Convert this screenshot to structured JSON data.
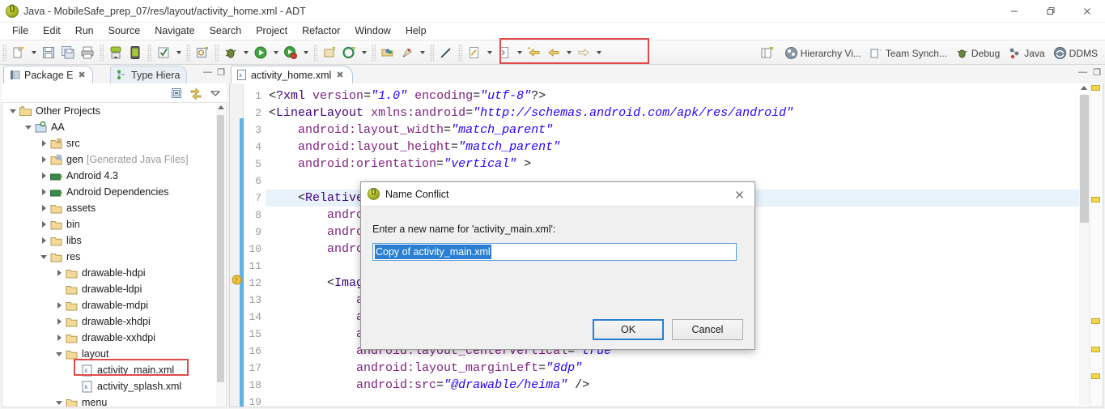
{
  "window": {
    "title": "Java - MobileSafe_prep_07/res/layout/activity_home.xml - ADT",
    "minimize_label": "Minimize",
    "restore_label": "Restore",
    "close_label": "Close"
  },
  "menubar": {
    "items": [
      {
        "label": "File"
      },
      {
        "label": "Edit"
      },
      {
        "label": "Run"
      },
      {
        "label": "Source"
      },
      {
        "label": "Navigate"
      },
      {
        "label": "Search"
      },
      {
        "label": "Project"
      },
      {
        "label": "Refactor"
      },
      {
        "label": "Window"
      },
      {
        "label": "Help"
      }
    ]
  },
  "toolbar": {
    "highlight_color": "#e04a4a",
    "buttons": [
      {
        "name": "new-wizard",
        "icon": "new-file-icon"
      },
      {
        "name": "save",
        "icon": "save-icon"
      },
      {
        "name": "save-all",
        "icon": "save-all-icon"
      },
      {
        "name": "print",
        "icon": "print-icon"
      },
      {
        "name": "android-sdk-manager",
        "icon": "sdk-manager-icon"
      },
      {
        "name": "android-virtual-device-manager",
        "icon": "avd-manager-icon"
      },
      {
        "name": "toggle-mark-occurrences",
        "icon": "checkbox-icon"
      },
      {
        "name": "new-android-project",
        "icon": "android-project-icon"
      },
      {
        "name": "debug",
        "icon": "debug-bug-icon"
      },
      {
        "name": "run",
        "icon": "run-play-icon"
      },
      {
        "name": "run-coverage",
        "icon": "coverage-icon"
      },
      {
        "name": "new-java-package",
        "icon": "package-icon"
      },
      {
        "name": "new-java-class",
        "icon": "java-class-icon"
      },
      {
        "name": "open-type",
        "icon": "open-type-icon"
      },
      {
        "name": "external-tools",
        "icon": "external-tools-icon"
      },
      {
        "name": "search",
        "icon": "search-pencil-icon"
      },
      {
        "name": "last-edit-location",
        "icon": "last-edit-icon"
      },
      {
        "name": "next-annotation",
        "icon": "next-annotation-icon"
      },
      {
        "name": "previous-edit",
        "icon": "previous-edit-icon"
      },
      {
        "name": "back",
        "icon": "back-arrow-icon"
      },
      {
        "name": "forward",
        "icon": "forward-arrow-icon"
      }
    ],
    "perspectives": [
      {
        "label": "",
        "icon": "open-perspective-icon",
        "name": "open-perspective"
      },
      {
        "label": "Hierarchy Vi...",
        "icon": "hierarchy-view-icon",
        "name": "perspective-hierarchy-view"
      },
      {
        "label": "Team Synch...",
        "icon": "team-sync-icon",
        "name": "perspective-team-sync"
      },
      {
        "label": "Debug",
        "icon": "debug-perspective-icon",
        "name": "perspective-debug"
      },
      {
        "label": "Java",
        "icon": "java-perspective-icon",
        "name": "perspective-java"
      },
      {
        "label": "DDMS",
        "icon": "ddms-icon",
        "name": "perspective-ddms"
      }
    ]
  },
  "left_view": {
    "tabs": [
      {
        "label": "Package E",
        "icon": "package-explorer-icon",
        "active": true,
        "close": "✖"
      },
      {
        "label": "Type Hiera",
        "icon": "type-hierarchy-icon",
        "active": false
      }
    ],
    "view_controls": {
      "minimize": "—",
      "maximize": "❐"
    },
    "toolbar": [
      {
        "name": "collapse-all",
        "icon": "collapse-all-icon"
      },
      {
        "name": "link-with-editor",
        "icon": "link-editor-icon"
      },
      {
        "name": "view-menu",
        "icon": "view-menu-icon"
      }
    ],
    "tree": [
      {
        "label": "Other Projects",
        "indent": 0,
        "state": "open",
        "icon": "project-group-icon"
      },
      {
        "label": "AA",
        "indent": 1,
        "state": "open",
        "icon": "java-project-icon"
      },
      {
        "label": "src",
        "indent": 2,
        "state": "closed",
        "icon": "source-folder-icon"
      },
      {
        "label": "gen",
        "suffix": "[Generated Java Files]",
        "indent": 2,
        "state": "closed",
        "icon": "gen-folder-icon"
      },
      {
        "label": "Android 4.3",
        "indent": 2,
        "state": "closed",
        "icon": "android-library-icon"
      },
      {
        "label": "Android Dependencies",
        "indent": 2,
        "state": "closed",
        "icon": "android-library-icon"
      },
      {
        "label": "assets",
        "indent": 2,
        "state": "closed",
        "icon": "folder-icon"
      },
      {
        "label": "bin",
        "indent": 2,
        "state": "closed",
        "icon": "folder-icon"
      },
      {
        "label": "libs",
        "indent": 2,
        "state": "closed",
        "icon": "folder-icon"
      },
      {
        "label": "res",
        "indent": 2,
        "state": "open",
        "icon": "folder-icon"
      },
      {
        "label": "drawable-hdpi",
        "indent": 3,
        "state": "closed",
        "icon": "folder-icon"
      },
      {
        "label": "drawable-ldpi",
        "indent": 3,
        "state": "leaf",
        "icon": "folder-icon"
      },
      {
        "label": "drawable-mdpi",
        "indent": 3,
        "state": "closed",
        "icon": "folder-icon"
      },
      {
        "label": "drawable-xhdpi",
        "indent": 3,
        "state": "closed",
        "icon": "folder-icon"
      },
      {
        "label": "drawable-xxhdpi",
        "indent": 3,
        "state": "closed",
        "icon": "folder-icon"
      },
      {
        "label": "layout",
        "indent": 3,
        "state": "open",
        "icon": "folder-icon"
      },
      {
        "label": "activity_main.xml",
        "indent": 4,
        "state": "leaf",
        "icon": "xml-file-icon",
        "highlighted": true
      },
      {
        "label": "activity_splash.xml",
        "indent": 4,
        "state": "leaf",
        "icon": "xml-file-icon"
      },
      {
        "label": "menu",
        "indent": 3,
        "state": "open",
        "icon": "folder-icon"
      }
    ]
  },
  "editor": {
    "tab": {
      "label": "activity_home.xml",
      "icon": "xml-file-icon",
      "close": "✖"
    },
    "controls": {
      "minimize": "—",
      "maximize": "❐"
    },
    "current_line": 7,
    "warning_line": 12,
    "lines": [
      {
        "n": 1,
        "text": "<?xml version=\"1.0\" encoding=\"utf-8\"?>"
      },
      {
        "n": 2,
        "text": "<LinearLayout xmlns:android=\"http://schemas.android.com/apk/res/android\""
      },
      {
        "n": 3,
        "text": "    android:layout_width=\"match_parent\""
      },
      {
        "n": 4,
        "text": "    android:layout_height=\"match_parent\""
      },
      {
        "n": 5,
        "text": "    android:orientation=\"vertical\" >"
      },
      {
        "n": 6,
        "text": ""
      },
      {
        "n": 7,
        "text": "    <RelativeLayout"
      },
      {
        "n": 8,
        "text": "        android:layout_width=\"match_parent\""
      },
      {
        "n": 9,
        "text": "        android:layout_height=\"wrap_content\""
      },
      {
        "n": 10,
        "text": "        android:background=\"@drawable/title_bg\" >"
      },
      {
        "n": 11,
        "text": ""
      },
      {
        "n": 12,
        "text": "        <ImageView"
      },
      {
        "n": 13,
        "text": "            android:id=\"@+id/iv_icon\""
      },
      {
        "n": 14,
        "text": "            android:layout_width=\"wrap_content\""
      },
      {
        "n": 15,
        "text": "            android:layout_height=\"wrap_content\""
      },
      {
        "n": 16,
        "text": "            android:layout_centerVertical=\"true\""
      },
      {
        "n": 17,
        "text": "            android:layout_marginLeft=\"8dp\""
      },
      {
        "n": 18,
        "text": "            android:src=\"@drawable/heima\" />"
      },
      {
        "n": 19,
        "text": ""
      }
    ]
  },
  "dialog": {
    "title": "Name Conflict",
    "icon": "info-icon",
    "close": "✕",
    "prompt": "Enter a new name for 'activity_main.xml':",
    "input_value": "Copy of activity_main.xml",
    "input_placeholder": "",
    "ok_label": "OK",
    "cancel_label": "Cancel",
    "selection_color": "#2a7fd4"
  }
}
